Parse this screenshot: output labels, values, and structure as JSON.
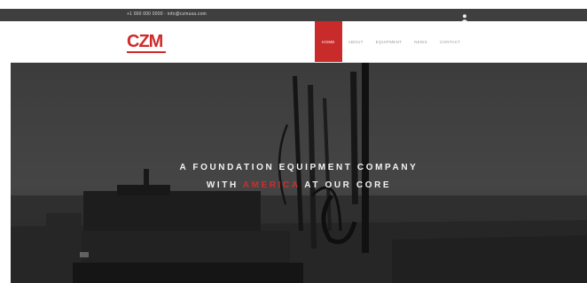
{
  "topbar": {
    "contact_text": "+1 000 000 0000 · info@czmusa.com",
    "account_icon": "user-icon"
  },
  "header": {
    "logo_text": "CZM",
    "nav": [
      {
        "label": "Home",
        "active": true
      },
      {
        "label": "About",
        "active": false
      },
      {
        "label": "Equipment",
        "active": false
      },
      {
        "label": "News",
        "active": false
      },
      {
        "label": "Contact",
        "active": false
      }
    ]
  },
  "hero": {
    "line1": "A FOUNDATION EQUIPMENT COMPANY",
    "line2_pre": "WITH ",
    "line2_accent": "AMERICA",
    "line2_post": " AT OUR CORE"
  },
  "colors": {
    "accent": "#c92a2a",
    "topbar_bg": "#3f3f3f",
    "hero_bg": "#3a3a3a"
  }
}
